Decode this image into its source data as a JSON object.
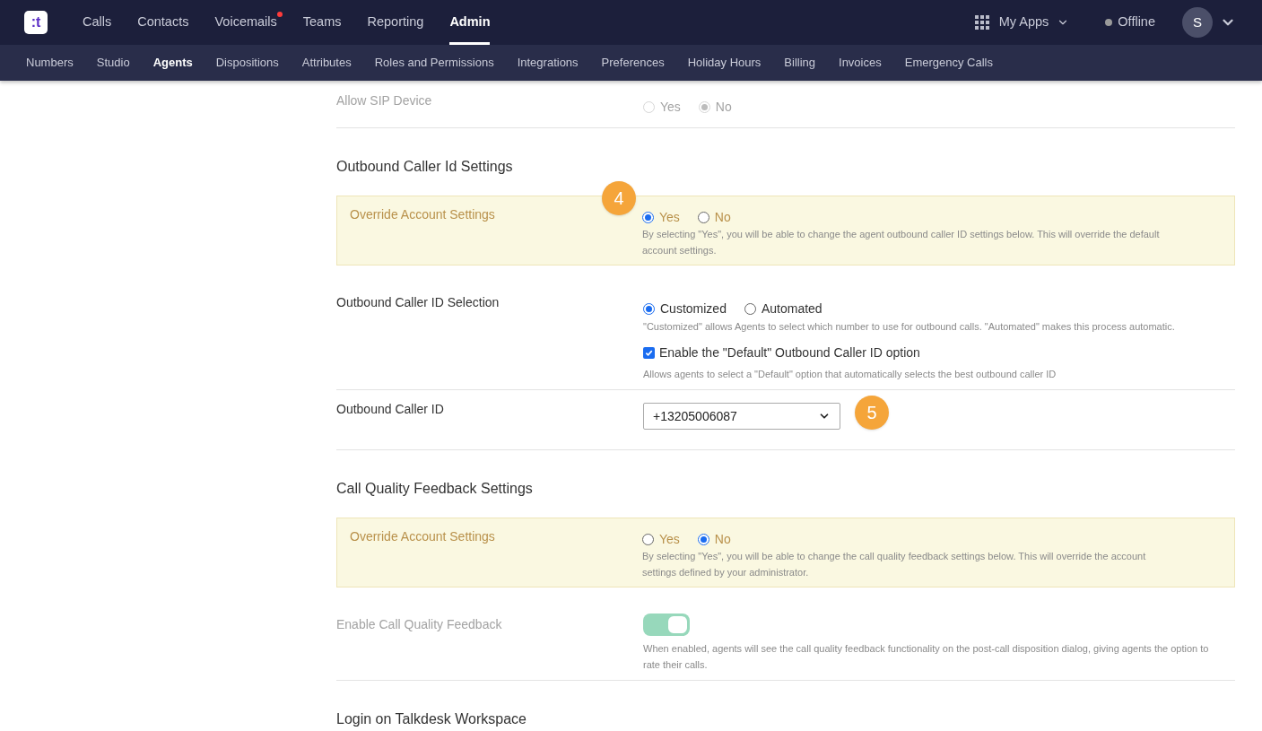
{
  "nav": {
    "logo": ":t",
    "items": [
      {
        "label": "Calls",
        "selected": false,
        "notification": false
      },
      {
        "label": "Contacts",
        "selected": false,
        "notification": false
      },
      {
        "label": "Voicemails",
        "selected": false,
        "notification": true
      },
      {
        "label": "Teams",
        "selected": false,
        "notification": false
      },
      {
        "label": "Reporting",
        "selected": false,
        "notification": false
      },
      {
        "label": "Admin",
        "selected": true,
        "notification": false
      }
    ],
    "my_apps": "My Apps",
    "status": "Offline",
    "avatar": "S"
  },
  "subnav": [
    {
      "label": "Numbers",
      "selected": false
    },
    {
      "label": "Studio",
      "selected": false
    },
    {
      "label": "Agents",
      "selected": true
    },
    {
      "label": "Dispositions",
      "selected": false
    },
    {
      "label": "Attributes",
      "selected": false
    },
    {
      "label": "Roles and Permissions",
      "selected": false
    },
    {
      "label": "Integrations",
      "selected": false
    },
    {
      "label": "Preferences",
      "selected": false
    },
    {
      "label": "Holiday Hours",
      "selected": false
    },
    {
      "label": "Billing",
      "selected": false
    },
    {
      "label": "Invoices",
      "selected": false
    },
    {
      "label": "Emergency Calls",
      "selected": false
    }
  ],
  "blocks": [
    {
      "kind": "radio_row",
      "label": "Allow SIP Device",
      "disabled": true,
      "divider": true,
      "options": [
        {
          "label": "Yes",
          "selected": false
        },
        {
          "label": "No",
          "selected": true
        }
      ]
    },
    {
      "kind": "heading",
      "text": "Outbound Caller Id Settings"
    },
    {
      "kind": "override",
      "label": "Override Account Settings",
      "badge": "4",
      "options": [
        {
          "label": "Yes",
          "selected": true
        },
        {
          "label": "No",
          "selected": false
        }
      ],
      "help": "By selecting \"Yes\", you will be able to change the agent outbound caller ID settings below. This will override the default account settings."
    },
    {
      "kind": "selection",
      "label": "Outbound Caller ID Selection",
      "divider": true,
      "options": [
        {
          "label": "Customized",
          "selected": true
        },
        {
          "label": "Automated",
          "selected": false
        }
      ],
      "help": "\"Customized\" allows Agents to select which number to use for outbound calls. \"Automated\" makes this process automatic.",
      "checkbox": {
        "label": "Enable the \"Default\" Outbound Caller ID option",
        "checked": true
      },
      "checkbox_help": "Allows agents to select a \"Default\" option that automatically selects the best outbound caller ID"
    },
    {
      "kind": "select",
      "label": "Outbound Caller ID",
      "divider": true,
      "value": "+13205006087",
      "badge": "5"
    },
    {
      "kind": "heading",
      "text": "Call Quality Feedback Settings"
    },
    {
      "kind": "override",
      "label": "Override Account Settings",
      "options": [
        {
          "label": "Yes",
          "selected": false
        },
        {
          "label": "No",
          "selected": true
        }
      ],
      "help": "By selecting \"Yes\", you will be able to change the call quality feedback settings below. This will override the account settings defined by your administrator."
    },
    {
      "kind": "toggle",
      "label": "Enable Call Quality Feedback",
      "disabled": true,
      "divider": true,
      "on": true,
      "help": "When enabled, agents will see the call quality feedback functionality on the post-call disposition dialog, giving agents the option to rate their calls."
    },
    {
      "kind": "heading",
      "text": "Login on Talkdesk Workspace"
    }
  ]
}
